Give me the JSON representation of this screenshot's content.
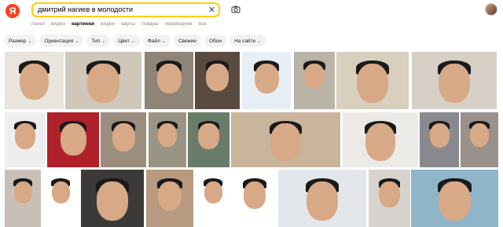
{
  "logo": "Я",
  "search": {
    "query": "дмитрий нагиев в молодости"
  },
  "tabs": [
    "поиск",
    "видео",
    "картинки",
    "видео",
    "карты",
    "товары",
    "переводчик",
    "все"
  ],
  "active_tab": "картинки",
  "filters": [
    {
      "label": "Размер",
      "dropdown": true
    },
    {
      "label": "Ориентация",
      "dropdown": true
    },
    {
      "label": "Тип",
      "dropdown": true
    },
    {
      "label": "Цвет",
      "dropdown": true
    },
    {
      "label": "Файл",
      "dropdown": true
    },
    {
      "label": "Свежие",
      "dropdown": false
    },
    {
      "label": "Обои",
      "dropdown": false
    },
    {
      "label": "На сайте",
      "dropdown": true
    }
  ],
  "colors": {
    "accent": "#ffcc00",
    "logo": "#fc3f1d",
    "chip_bg": "#f2f2f2"
  },
  "icons": [
    "yandex-logo-icon",
    "clear-icon",
    "camera-search-icon",
    "user-avatar-icon",
    "chevron-down-icon"
  ]
}
